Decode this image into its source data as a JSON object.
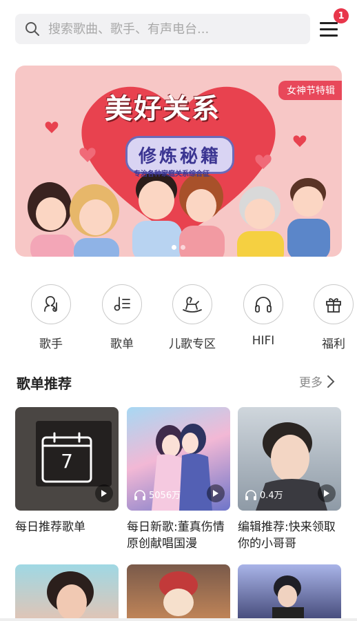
{
  "search": {
    "placeholder": "搜索歌曲、歌手、有声电台..."
  },
  "notifications": {
    "count": "1"
  },
  "banner": {
    "tag": "女神节特辑",
    "title": "美好关系",
    "subtitle": "修炼秘籍",
    "small_text": "专治各种家庭关系综合征"
  },
  "quick_nav": [
    {
      "label": "歌手",
      "icon": "singer-icon"
    },
    {
      "label": "歌单",
      "icon": "playlist-icon"
    },
    {
      "label": "儿歌专区",
      "icon": "rocking-horse-icon"
    },
    {
      "label": "HIFI",
      "icon": "headphones-icon"
    },
    {
      "label": "福利",
      "icon": "gift-icon"
    }
  ],
  "section": {
    "title": "歌单推荐",
    "more": "更多"
  },
  "playlists": [
    {
      "title": "每日推荐歌单",
      "date": "7",
      "plays": ""
    },
    {
      "title": "每日新歌:董真伤情原创献唱国漫",
      "plays": "5056万"
    },
    {
      "title": "编辑推荐:快来领取你的小哥哥",
      "plays": "0.4万"
    }
  ],
  "colors": {
    "accent": "#e8364b",
    "banner_bg": "#f7c7c6"
  }
}
